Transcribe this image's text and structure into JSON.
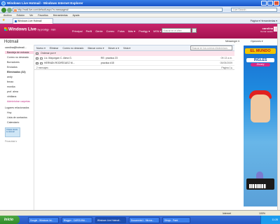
{
  "window": {
    "title": "Windows Live Hotmail - Windows Internet Explorer"
  },
  "address": {
    "url": "http://mail.live.com/default.aspx?n=messages#",
    "search_placeholder": "Live Search"
  },
  "menu": [
    "Archivo",
    "Edición",
    "Ver",
    "Favoritos",
    "Herramientas",
    "Ayuda"
  ],
  "tab": {
    "label": "Windows Live Hotmail"
  },
  "commands": "Página ▾  Herramientas ▾",
  "wl": {
    "brand": "Windows Live",
    "brand_sub": "by prodigy · msn",
    "nav": [
      "Principal",
      "Perfil",
      "Gente",
      "Correo",
      "Fotos",
      "Más ▾",
      "Prodigy ▾",
      "MSN ▾"
    ],
    "search_placeholder": "Buscar en el Web",
    "user": "carolina",
    "user_sub": "Cerrar sesión"
  },
  "page": {
    "title": "Hotmail",
    "messenger": "Messenger ▾",
    "options": "Opciones ▾"
  },
  "toolbar": {
    "items": [
      "Nuevo ▾",
      "Eliminar",
      "Correo no deseado",
      "Marcar como ▾",
      "Mover a ▾",
      "Vista ▾"
    ],
    "search_placeholder": "Buscar en los correos electrónicos"
  },
  "sidebar": {
    "account": "carolina@hotmail...",
    "items": [
      {
        "label": "Bandeja de entrada",
        "active": true
      },
      {
        "label": "Correo no deseado"
      },
      {
        "label": "Borradores"
      },
      {
        "label": "Enviados"
      },
      {
        "label": "Eliminados (32)",
        "bold": true
      },
      {
        "label": "andy"
      },
      {
        "label": "ferran"
      },
      {
        "label": "monika"
      },
      {
        "label": "prof. alma"
      },
      {
        "label": "viridiana"
      },
      {
        "label": "Administrar carpetas",
        "link": true
      }
    ],
    "groups": [
      "Lugares relacionados",
      "Hoy",
      "Lista de contactos",
      "Calendario"
    ],
    "promo": "Chatea desde tu Hotmail",
    "footer": "Privacidad ▾"
  },
  "list": {
    "filter": "Ordenar por ▾",
    "messages": [
      {
        "from": "Lic. Mayorgan C. Alma G.",
        "subject": "RE: practica 23",
        "date": "09:13 a.m."
      },
      {
        "from": "HERNÁN RODRÍGUEZ M...",
        "subject": "practica #15",
        "date": "05/05/2009"
      }
    ],
    "count": "2 mensajes",
    "pager": "Página 1 ▸"
  },
  "ad": {
    "title": "EL MUNDO",
    "subtitle": "INGLÉS",
    "brand": "Disney"
  },
  "status": {
    "zone": "Internet",
    "zoom": "100%"
  },
  "taskbar": {
    "start": "Inicio",
    "buttons": [
      "Google - Windows Int...",
      "Blogger - CAROLINA...",
      "Windows Live Hotmail...",
      "Documento1 - Micros...",
      "Dibujo - Paint"
    ],
    "clock": "11:28"
  },
  "colors": {
    "hotmail_header": "#b81a5e",
    "selected_folder": "#fcd3e3"
  }
}
